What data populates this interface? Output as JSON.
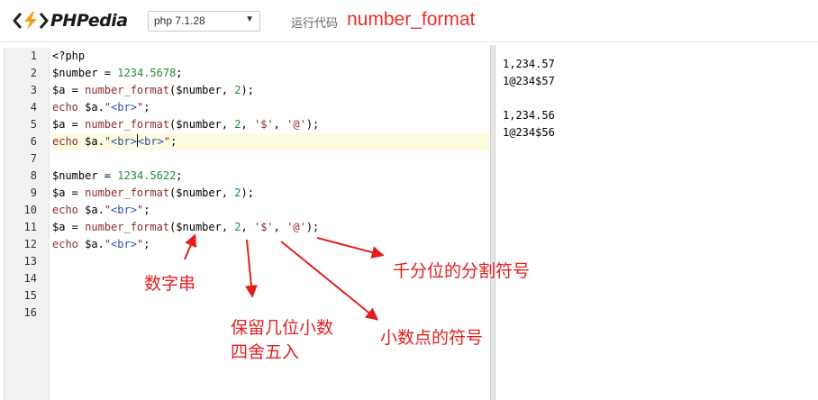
{
  "header": {
    "logo_text": "PHPedia",
    "version": "php 7.1.28",
    "run_label": "运行代码",
    "function_title": "number_format"
  },
  "editor": {
    "line_numbers": [
      "1",
      "2",
      "3",
      "4",
      "5",
      "6",
      "7",
      "8",
      "9",
      "10",
      "11",
      "12",
      "13",
      "14",
      "15",
      "16"
    ],
    "active_line": 6,
    "code": {
      "l1": "<?php",
      "l2_var": "$number",
      "l2_eq": " = ",
      "l2_num": "1234.5678",
      "l2_end": ";",
      "l3_a": "$a = ",
      "l3_fn": "number_format",
      "l3_p1": "($number, ",
      "l3_num": "2",
      "l3_end": ");",
      "l4_kw": "echo",
      "l4_a": " $a.",
      "l4_q1": "\"",
      "l4_str": "<br>",
      "l4_q2": "\"",
      "l4_end": ";",
      "l5_a": "$a = ",
      "l5_fn": "number_format",
      "l5_p1": "($number, ",
      "l5_num": "2",
      "l5_c1": ", ",
      "l5_s1": "'$'",
      "l5_c2": ", ",
      "l5_s2": "'@'",
      "l5_end": ");",
      "l6_kw": "echo",
      "l6_a": " $a.",
      "l6_q1": "\"",
      "l6_str1": "<br>",
      "l6_str2": "<br>",
      "l6_q2": "\"",
      "l6_end": ";",
      "l8_var": "$number",
      "l8_eq": " = ",
      "l8_num": "1234.5622",
      "l8_end": ";",
      "l9_a": "$a = ",
      "l9_fn": "number_format",
      "l9_p1": "($number, ",
      "l9_num": "2",
      "l9_end": ");",
      "l10_kw": "echo",
      "l10_a": " $a.",
      "l10_q1": "\"",
      "l10_str": "<br>",
      "l10_q2": "\"",
      "l10_end": ";",
      "l11_a": "$a = ",
      "l11_fn": "number_format",
      "l11_p1": "($number, ",
      "l11_num": "2",
      "l11_c1": ", ",
      "l11_s1": "'$'",
      "l11_c2": ", ",
      "l11_s2": "'@'",
      "l11_end": ");",
      "l12_kw": "echo",
      "l12_a": " $a.",
      "l12_q1": "\"",
      "l12_str": "<br>",
      "l12_q2": "\"",
      "l12_end": ";"
    }
  },
  "output": {
    "lines": [
      "1,234.57",
      "1@234$57",
      "",
      "1,234.56",
      "1@234$56"
    ]
  },
  "annotations": {
    "number_string": "数字串",
    "decimals_line1": "保留几位小数",
    "decimals_line2": "四舍五入",
    "decimal_point": "小数点的符号",
    "thousands_sep": "千分位的分割符号"
  },
  "colors": {
    "annotation_red": "#e02020",
    "title_red": "#e8302a",
    "active_line": "#fdfbe0",
    "number_green": "#1f8a3b",
    "string_blue": "#2b4faa",
    "keyword_maroon": "#8a2d2d"
  }
}
